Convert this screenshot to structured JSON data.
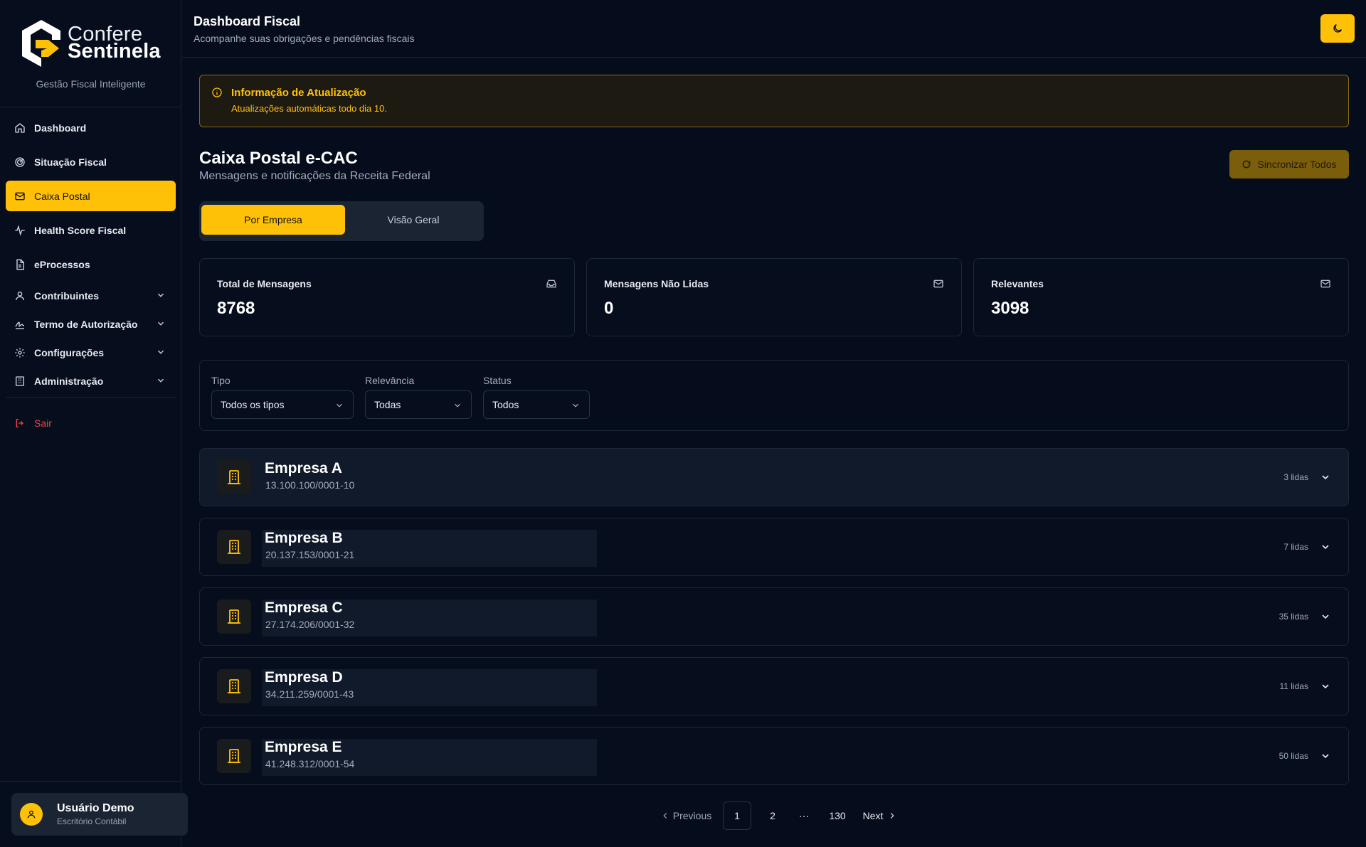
{
  "brand": {
    "line1": "Confere",
    "line2": "Sentinela",
    "tagline": "Gestão Fiscal Inteligente"
  },
  "sidebar": {
    "items": [
      {
        "label": "Dashboard",
        "icon": "home-icon"
      },
      {
        "label": "Situação Fiscal",
        "icon": "radar-icon"
      },
      {
        "label": "Caixa Postal",
        "icon": "mail-icon",
        "active": true
      },
      {
        "label": "Health Score Fiscal",
        "icon": "activity-icon"
      },
      {
        "label": "eProcessos",
        "icon": "file-icon"
      }
    ],
    "groups": [
      {
        "label": "Contribuintes",
        "icon": "user-icon"
      },
      {
        "label": "Termo de Autorização",
        "icon": "signature-icon"
      },
      {
        "label": "Configurações",
        "icon": "gear-icon"
      },
      {
        "label": "Administração",
        "icon": "building-icon"
      }
    ],
    "logout": "Sair"
  },
  "user": {
    "name": "Usuário Demo",
    "role": "Escritório Contábil"
  },
  "header": {
    "title": "Dashboard Fiscal",
    "subtitle": "Acompanhe suas obrigações e pendências fiscais"
  },
  "alert": {
    "title": "Informação de Atualização",
    "text": "Atualizações automáticas todo dia 10."
  },
  "section": {
    "title": "Caixa Postal e-CAC",
    "subtitle": "Mensagens e notificações da Receita Federal",
    "sync_label": "Sincronizar Todos"
  },
  "tabs": {
    "active": "Por Empresa",
    "inactive": "Visão Geral"
  },
  "stats": [
    {
      "label": "Total de Mensagens",
      "value": "8768",
      "icon": "inbox-icon"
    },
    {
      "label": "Mensagens Não Lidas",
      "value": "0",
      "icon": "mail-icon"
    },
    {
      "label": "Relevantes",
      "value": "3098",
      "icon": "mail-icon"
    }
  ],
  "filters": {
    "tipo": {
      "label": "Tipo",
      "value": "Todos os tipos"
    },
    "relevancia": {
      "label": "Relevância",
      "value": "Todas"
    },
    "status": {
      "label": "Status",
      "value": "Todos"
    }
  },
  "companies": [
    {
      "name": "Empresa A",
      "cnpj": "13.100.100/0001-10",
      "count": "3 lidas"
    },
    {
      "name": "Empresa B",
      "cnpj": "20.137.153/0001-21",
      "count": "7 lidas"
    },
    {
      "name": "Empresa C",
      "cnpj": "27.174.206/0001-32",
      "count": "35 lidas"
    },
    {
      "name": "Empresa D",
      "cnpj": "34.211.259/0001-43",
      "count": "11 lidas"
    },
    {
      "name": "Empresa E",
      "cnpj": "41.248.312/0001-54",
      "count": "50 lidas"
    }
  ],
  "pagination": {
    "previous": "Previous",
    "next": "Next",
    "pages": [
      "1",
      "2",
      "130"
    ],
    "ellipsis": "···",
    "current": "1"
  },
  "colors": {
    "accent": "#ffc107",
    "background": "#050c1c",
    "danger": "#ef4444"
  }
}
